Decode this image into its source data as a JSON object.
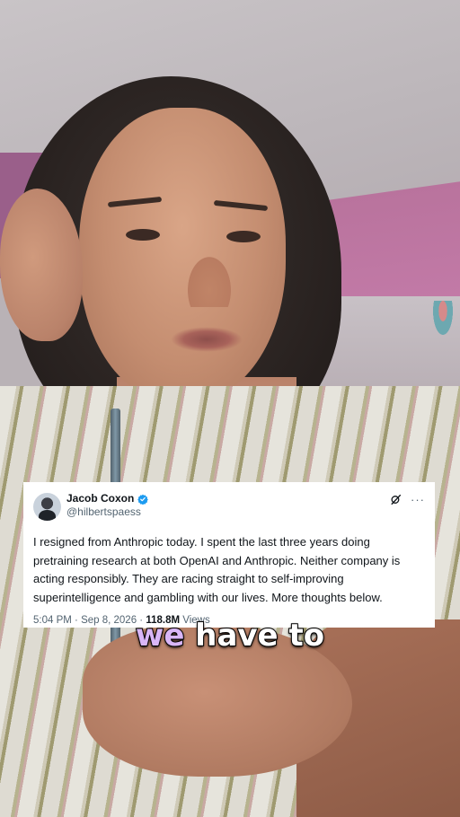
{
  "tweet": {
    "display_name": "Jacob Coxon",
    "handle": "@hilbertspaess",
    "verified": true,
    "text": "I resigned from Anthropic today. I spent the last three years doing pretraining research at both OpenAI and Anthropic. Neither company is acting responsibly. They are racing straight to self-improving superintelligence and gambling with our lives. More thoughts below.",
    "time": "5:04 PM",
    "date": "Sep 8, 2026",
    "views_count": "118.8M",
    "views_label": "Views",
    "icons": [
      "grok-icon",
      "more-icon",
      "verified-badge-icon"
    ]
  },
  "caption": {
    "highlight": "we",
    "rest": " have to"
  },
  "colors": {
    "verified_blue": "#1d9bf0",
    "caption_highlight": "#d9b6f7",
    "caption_text": "#ffffff",
    "meta_gray": "#536471"
  }
}
